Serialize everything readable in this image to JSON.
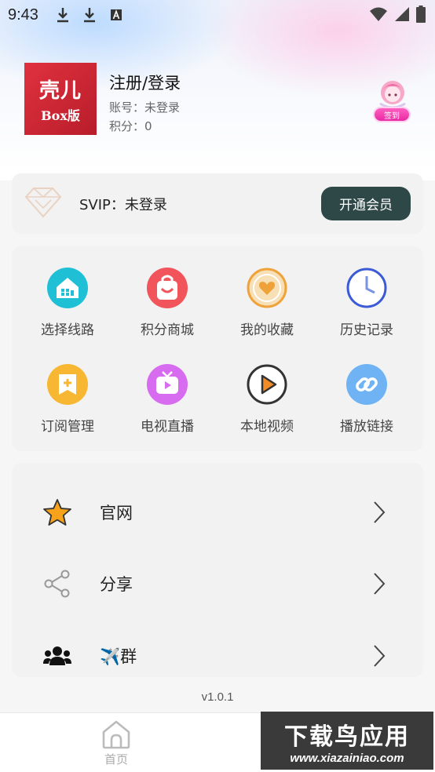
{
  "status": {
    "time": "9:43",
    "icons": [
      "download-icon",
      "download-icon",
      "font-a-icon",
      "wifi-icon",
      "signal-icon",
      "battery-icon"
    ]
  },
  "profile": {
    "logo_main": "壳儿",
    "logo_sub": "Box版",
    "title": "注册/登录",
    "account": "账号：未登录",
    "points": "积分：0",
    "signin_label": "签到"
  },
  "vip": {
    "label": "SVIP：未登录",
    "button": "开通会员"
  },
  "grid": {
    "items": [
      {
        "label": "选择线路",
        "icon": "route-house-icon",
        "color": "#1fbfd6"
      },
      {
        "label": "积分商城",
        "icon": "shopping-bag-icon",
        "color": "#f2545b"
      },
      {
        "label": "我的收藏",
        "icon": "heart-icon",
        "color": "#f0a23a"
      },
      {
        "label": "历史记录",
        "icon": "clock-icon",
        "color": "#3b5bd6"
      },
      {
        "label": "订阅管理",
        "icon": "bookmark-plus-icon",
        "color": "#f7b733"
      },
      {
        "label": "电视直播",
        "icon": "tv-icon",
        "color": "#d86cf0"
      },
      {
        "label": "本地视频",
        "icon": "play-circle-icon",
        "color": "#f28c28"
      },
      {
        "label": "播放链接",
        "icon": "link-icon",
        "color": "#6fb3f5"
      }
    ]
  },
  "list": {
    "items": [
      {
        "label": "官网",
        "icon": "star-icon"
      },
      {
        "label": "分享",
        "icon": "share-icon"
      },
      {
        "label": "✈️群",
        "icon": "group-icon"
      }
    ]
  },
  "version": "v1.0.1",
  "bottom_nav": {
    "home_label": "首页"
  },
  "watermark": {
    "main": "下载鸟应用",
    "sub": "www.xiazainiao.com"
  }
}
